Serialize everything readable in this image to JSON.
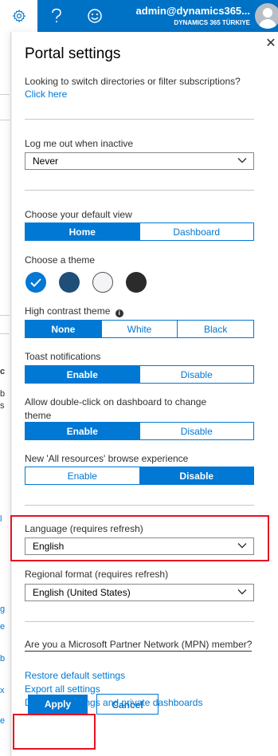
{
  "topbar": {
    "user_name": "admin@dynamics365...",
    "tenant": "DYNAMICS 365 TÜRKIYE"
  },
  "panel": {
    "title": "Portal settings",
    "switch_text": "Looking to switch directories or filter subscriptions?",
    "switch_link": "Click here",
    "logout_label": "Log me out when inactive",
    "logout_value": "Never",
    "default_view_label": "Choose your default view",
    "default_view_options": [
      "Home",
      "Dashboard"
    ],
    "theme_label": "Choose a theme",
    "themes": [
      {
        "name": "blue",
        "color": "#0078d4",
        "selected": true
      },
      {
        "name": "dark-blue",
        "color": "#1f4e79"
      },
      {
        "name": "light",
        "color": "#f4f4f6"
      },
      {
        "name": "dark",
        "color": "#2b2b2b"
      }
    ],
    "contrast_label": "High contrast theme",
    "contrast_options": [
      "None",
      "White",
      "Black"
    ],
    "toast_label": "Toast notifications",
    "toast_options": [
      "Enable",
      "Disable"
    ],
    "dblclick_label_1": "Allow double-click on dashboard to change",
    "dblclick_label_2": "theme",
    "dblclick_options": [
      "Enable",
      "Disable"
    ],
    "browse_label": "New 'All resources' browse experience",
    "browse_options": [
      "Enable",
      "Disable"
    ],
    "language_label": "Language (requires refresh)",
    "language_value": "English",
    "regional_label": "Regional format (requires refresh)",
    "regional_value": "English (United States)",
    "mpn_question": "Are you a Microsoft Partner Network (MPN) member?",
    "restore_link": "Restore default settings",
    "export_link": "Export all settings",
    "delete_link": "Delete all settings and private dashboards",
    "apply_label": "Apply",
    "cancel_label": "Cancel"
  },
  "colors": {
    "accent": "#0078d4",
    "topbar": "#0072c6",
    "highlight": "#e81123"
  }
}
